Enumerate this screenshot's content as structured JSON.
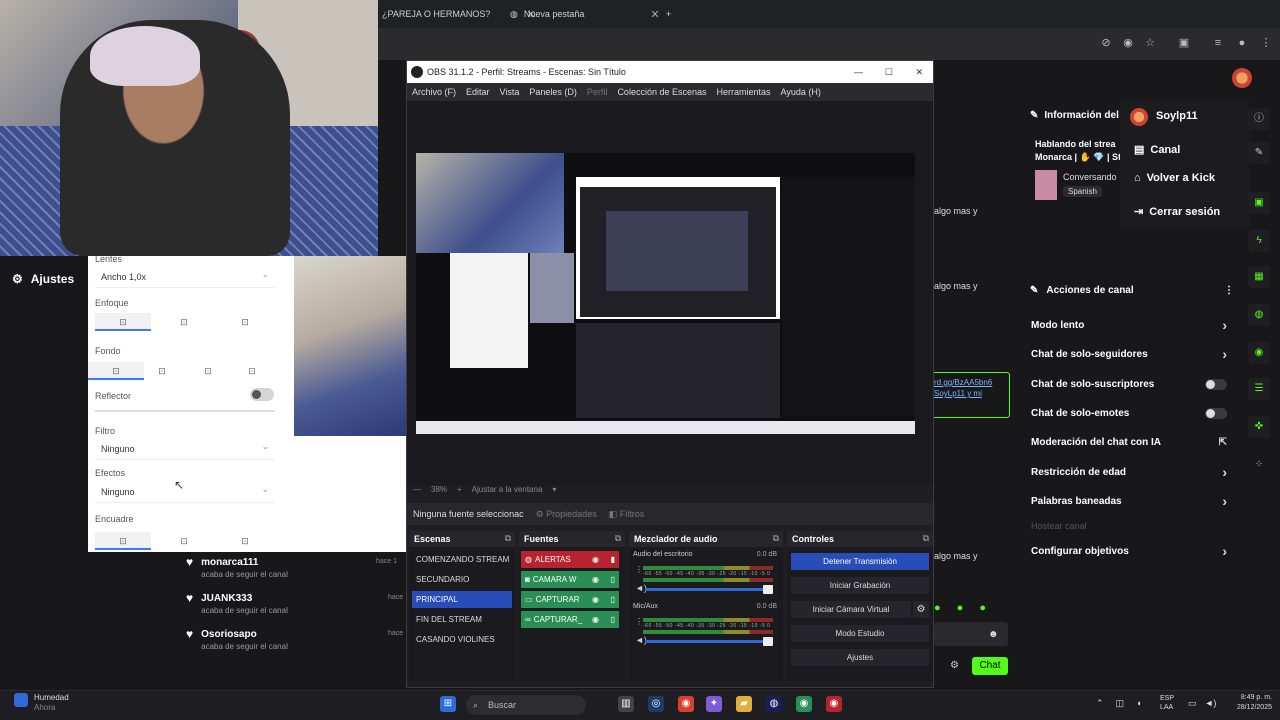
{
  "browser": {
    "tabs": [
      {
        "label": "¿PAREJA O HERMANOS?",
        "close": "✕"
      },
      {
        "label": "Nueva pestaña",
        "close": "✕"
      }
    ],
    "new_tab": "+"
  },
  "left_sidebar": {
    "settings_label": "Ajustes"
  },
  "camera_panel": {
    "lens_label": "Lentes",
    "lens_value": "Ancho 1,0x",
    "focus_label": "Enfoque",
    "background_label": "Fondo",
    "reflector_label": "Reflector",
    "filter_label": "Filtro",
    "filter_value": "Ninguno",
    "effects_label": "Efectos",
    "effects_value": "Ninguno",
    "framing_label": "Encuadre"
  },
  "follow_feed": [
    {
      "user": "monarca111",
      "action": "acaba de seguir el canal",
      "time": "hace 1"
    },
    {
      "user": "JUANK333",
      "action": "acaba de seguir el canal",
      "time": "hace"
    },
    {
      "user": "Osoriosapo",
      "action": "acaba de seguir el canal",
      "time": "hace"
    }
  ],
  "obs": {
    "title": "OBS 31.1.2 - Perfil: Streams - Escenas: Sin Título",
    "menu": [
      {
        "label": "Archivo (F)",
        "enabled": true
      },
      {
        "label": "Editar",
        "enabled": true
      },
      {
        "label": "Vista",
        "enabled": true
      },
      {
        "label": "Paneles (D)",
        "enabled": true
      },
      {
        "label": "Perfil",
        "enabled": false
      },
      {
        "label": "Colección de Escenas",
        "enabled": true
      },
      {
        "label": "Herramientas",
        "enabled": true
      },
      {
        "label": "Ayuda (H)",
        "enabled": true
      }
    ],
    "zoom": "38%",
    "fit_label": "Ajustar a la ventana",
    "no_source": "Ninguna fuente seleccionac",
    "properties": "Propiedades",
    "filters": "Filtros",
    "scenes_title": "Escenas",
    "scenes": [
      {
        "label": "COMENZANDO STREAM",
        "selected": false
      },
      {
        "label": "SECUNDARIO",
        "selected": false
      },
      {
        "label": "PRINCIPAL",
        "selected": true
      },
      {
        "label": "FIN DEL STREAM",
        "selected": false
      },
      {
        "label": "CASANDO VIOLINES",
        "selected": false
      }
    ],
    "sources_title": "Fuentes",
    "sources": [
      {
        "label": "ALERTAS",
        "color": "#b8232f"
      },
      {
        "label": "CAMARA W",
        "color": "#2a8f55"
      },
      {
        "label": "CAPTURAR",
        "color": "#2a8f55"
      },
      {
        "label": "CAPTURAR_",
        "color": "#2a8f55"
      }
    ],
    "mixer_title": "Mezclador de audio",
    "mixer": [
      {
        "name": "Audio del escritorio",
        "db": "0.0 dB"
      },
      {
        "name": "Mic/Aux",
        "db": "0.0 dB"
      }
    ],
    "meter_ticks": "-60 -55 -50 -45 -40 -35 -30 -25 -20 -15 -10 -5 0",
    "controls_title": "Controles",
    "controls": [
      {
        "label": "Detener Transmisión",
        "primary": true
      },
      {
        "label": "Iniciar Grabación",
        "primary": false
      },
      {
        "label": "Iniciar Cámara Virtual",
        "primary": false
      },
      {
        "label": "Modo Estudio",
        "primary": false
      },
      {
        "label": "Ajustes",
        "primary": false
      }
    ]
  },
  "stream_info": {
    "header": "Información del",
    "title": "Hablando del strea Monarca | ✋ 💎 | St",
    "category": "Conversando",
    "language": "Spanish"
  },
  "user_menu": {
    "username": "Soylp11",
    "items": [
      "Canal",
      "Volver a Kick",
      "Cerrar sesión"
    ]
  },
  "channel_actions": {
    "header": "Acciones de canal",
    "items": [
      {
        "label": "Modo lento",
        "control": "chevron",
        "enabled": true
      },
      {
        "label": "Chat de solo-seguidores",
        "control": "chevron",
        "enabled": true
      },
      {
        "label": "Chat de solo-suscriptores",
        "control": "switch",
        "enabled": true
      },
      {
        "label": "Chat de solo-emotes",
        "control": "switch",
        "enabled": true
      },
      {
        "label": "Moderación del chat con IA",
        "control": "external",
        "enabled": true
      },
      {
        "label": "Restricción de edad",
        "control": "chevron",
        "enabled": true
      },
      {
        "label": "Palabras baneadas",
        "control": "chevron",
        "enabled": true
      },
      {
        "label": "Hostear canal",
        "control": "none",
        "enabled": false
      },
      {
        "label": "Configurar objetivos",
        "control": "chevron",
        "enabled": true
      }
    ]
  },
  "chat": {
    "fragments": [
      "algo mas y",
      "algo mas y",
      "algo mas y"
    ],
    "link": "rd.gg/BzAA5bn6 SoyLp11 y mi",
    "send_label": "Chat"
  },
  "taskbar": {
    "weather_title": "Humedad",
    "weather_sub": "Ahora",
    "search": "Buscar",
    "lang_top": "ESP",
    "lang_bottom": "LAA",
    "time": "8:49 p. m.",
    "date": "28/12/2025"
  },
  "colors": {
    "kick_green": "#53fc18",
    "obs_blue": "#284cb8"
  }
}
